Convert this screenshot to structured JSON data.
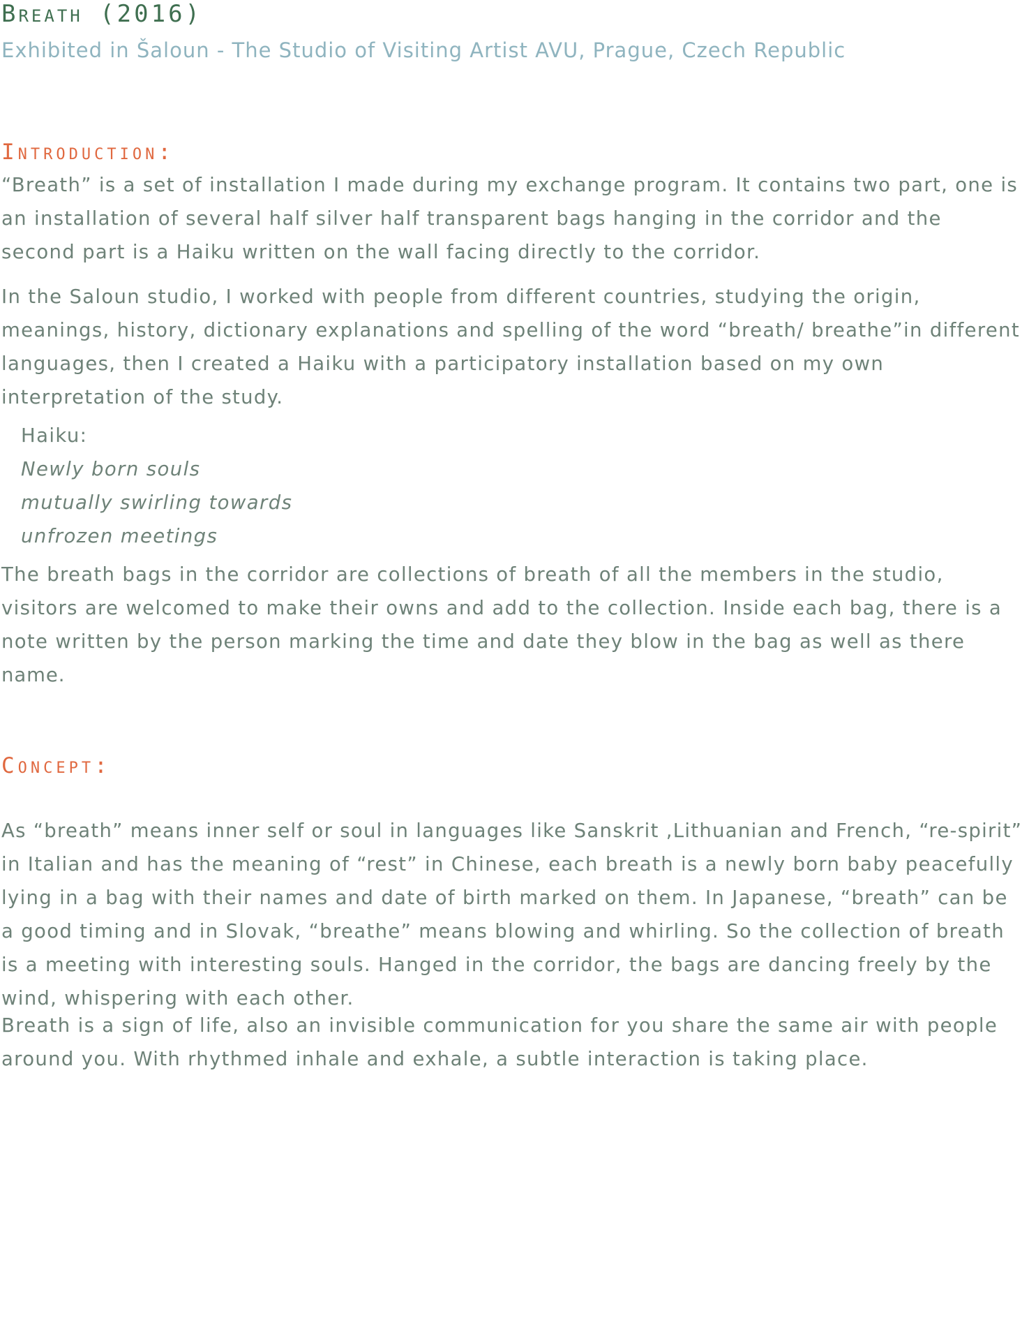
{
  "header": {
    "title": "Breath (2016)",
    "subtitle": "Exhibited in Šaloun - The Studio of Visiting Artist AVU, Prague, Czech Republic"
  },
  "introduction": {
    "heading": "Introduction:",
    "paragraph1": [
      "“Breath” is a set of installation I made during my exchange program. It contains two part, one is",
      "an installation of several half silver half transparent bags hanging in the corridor and the",
      "second part is a Haiku written on the wall facing directly to the corridor."
    ],
    "paragraph2": [
      "In the Saloun studio, I worked with people from different countries, studying the origin,",
      "meanings, history, dictionary explanations and spelling of the word “breath/ breathe”in different",
      "languages, then I created a Haiku with a participatory installation based on my own",
      "interpretation of the study."
    ],
    "haiku": {
      "label": "Haiku:",
      "lines": [
        "Newly born souls",
        "mutually swirling towards",
        "unfrozen meetings"
      ]
    },
    "paragraph3": [
      "The breath bags in the corridor are collections of breath of all the members in the studio,",
      "visitors are welcomed to make their owns and add to the collection. Inside each bag, there is a",
      "note written by the person marking the time and date they blow in the bag as well as there",
      "name."
    ]
  },
  "concept": {
    "heading": "Concept:",
    "paragraph1": [
      "As “breath” means inner self or soul in languages like Sanskrit ,Lithuanian and French, “re-spirit”",
      "in Italian and has the meaning of “rest” in Chinese, each breath is a newly born baby peacefully",
      "lying in a bag with their names and date of birth marked on them. In Japanese, “breath” can be",
      "a good timing and in Slovak, “breathe” means blowing and whirling. So the collection of breath",
      "is a meeting with interesting souls. Hanged in the corridor, the bags are dancing freely by the",
      "wind, whispering with each other."
    ],
    "paragraph2": [
      "Breath is a sign of life, also an invisible communication for you share the same air with people",
      "around you. With rhythmed inhale and exhale, a subtle interaction is taking place."
    ]
  },
  "colors": {
    "title": "#3f6f50",
    "subtitle": "#8fb4bf",
    "section_heading": "#e0683f",
    "body_text": "#6e8278",
    "background": "#ffffff"
  }
}
